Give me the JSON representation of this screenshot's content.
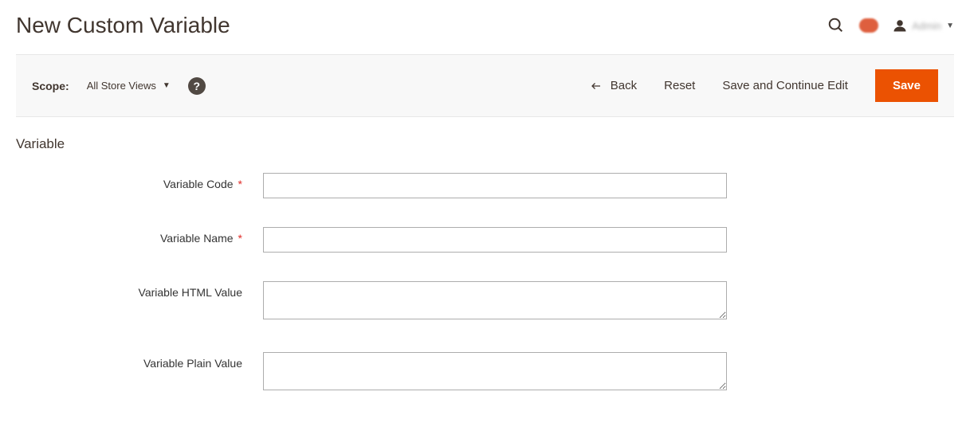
{
  "header": {
    "title": "New Custom Variable",
    "user_name": "Admin"
  },
  "toolbar": {
    "scope_label": "Scope:",
    "scope_value": "All Store Views",
    "back_label": "Back",
    "reset_label": "Reset",
    "save_continue_label": "Save and Continue Edit",
    "save_label": "Save"
  },
  "form": {
    "section_title": "Variable",
    "fields": {
      "code": {
        "label": "Variable Code",
        "required": true,
        "value": ""
      },
      "name": {
        "label": "Variable Name",
        "required": true,
        "value": ""
      },
      "html_value": {
        "label": "Variable HTML Value",
        "required": false,
        "value": ""
      },
      "plain_value": {
        "label": "Variable Plain Value",
        "required": false,
        "value": ""
      }
    }
  }
}
